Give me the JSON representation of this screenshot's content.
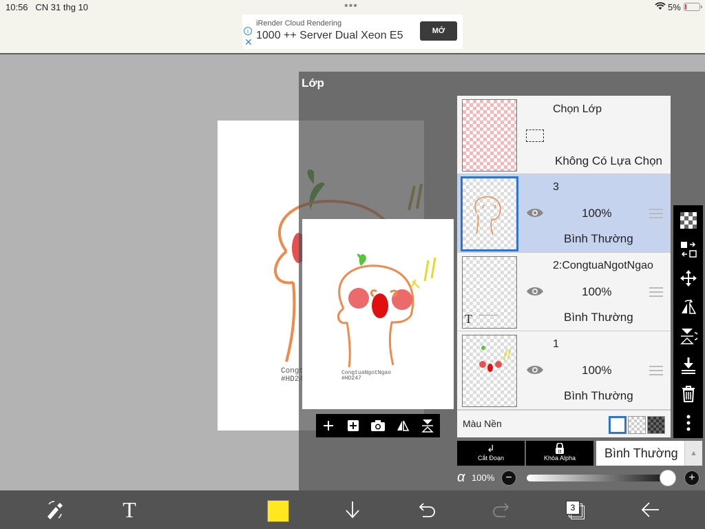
{
  "status": {
    "time": "10:56",
    "date": "CN 31 thg 10",
    "battery": "5%"
  },
  "ad": {
    "small_text": "iRender Cloud Rendering",
    "headline": "1000 ++ Server Dual Xeon E5",
    "button": "MỞ"
  },
  "panel": {
    "title": "Lớp",
    "selection_row": {
      "title": "Chọn Lớp",
      "subtitle": "Không Có Lựa Chọn"
    },
    "layers": [
      {
        "name": "3",
        "opacity": "100%",
        "mode": "Bình Thường",
        "selected": true
      },
      {
        "name": "2:CongtuaNgotNgao",
        "opacity": "100%",
        "mode": "Bình Thường",
        "selected": false
      },
      {
        "name": "1",
        "opacity": "100%",
        "mode": "Bình Thường",
        "selected": false
      }
    ],
    "background_label": "Màu Nền",
    "clip_label": "Cắt Đoạn",
    "alpha_lock_label": "Khóa Alpha",
    "blend_mode": "Bình Thường",
    "opacity_label": "100%",
    "opacity_value": 1.0
  },
  "canvas": {
    "watermark_line1": "CongtuaNgotNgao",
    "watermark_line2": "#HD247"
  },
  "toolbar": {
    "layer_count": "3",
    "current_color": "#ffe81e"
  },
  "icons": [
    "transform-icon",
    "text-icon",
    "download-icon",
    "undo-icon",
    "redo-icon",
    "layers-icon",
    "back-arrow-icon"
  ]
}
